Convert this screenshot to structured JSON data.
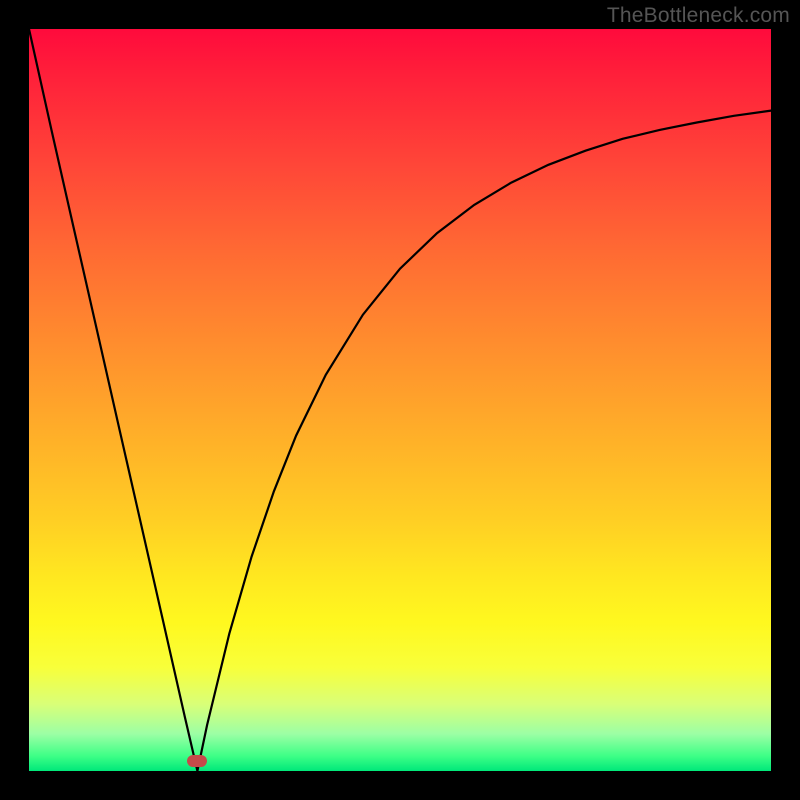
{
  "watermark": "TheBottleneck.com",
  "colors": {
    "frame": "#000000",
    "curve_stroke": "#000000",
    "dot_fill": "#c54a4a"
  },
  "chart_data": {
    "type": "line",
    "title": "",
    "xlabel": "",
    "ylabel": "",
    "xlim": [
      0,
      100
    ],
    "ylim": [
      0,
      100
    ],
    "grid": false,
    "legend": false,
    "annotations": [
      {
        "label": "min-marker",
        "x": 22.7,
        "y": 1.3
      }
    ],
    "series": [
      {
        "name": "bottleneck-curve",
        "x": [
          0,
          3,
          6,
          9,
          12,
          15,
          18,
          21,
          22.7,
          24,
          27,
          30,
          33,
          36,
          40,
          45,
          50,
          55,
          60,
          65,
          70,
          75,
          80,
          85,
          90,
          95,
          100
        ],
        "values": [
          100,
          86.5,
          73.3,
          60.1,
          46.9,
          33.7,
          20.5,
          7.3,
          0.0,
          6.2,
          18.5,
          28.9,
          37.7,
          45.2,
          53.4,
          61.5,
          67.7,
          72.5,
          76.3,
          79.3,
          81.7,
          83.6,
          85.2,
          86.4,
          87.4,
          88.3,
          89.0
        ]
      }
    ]
  }
}
